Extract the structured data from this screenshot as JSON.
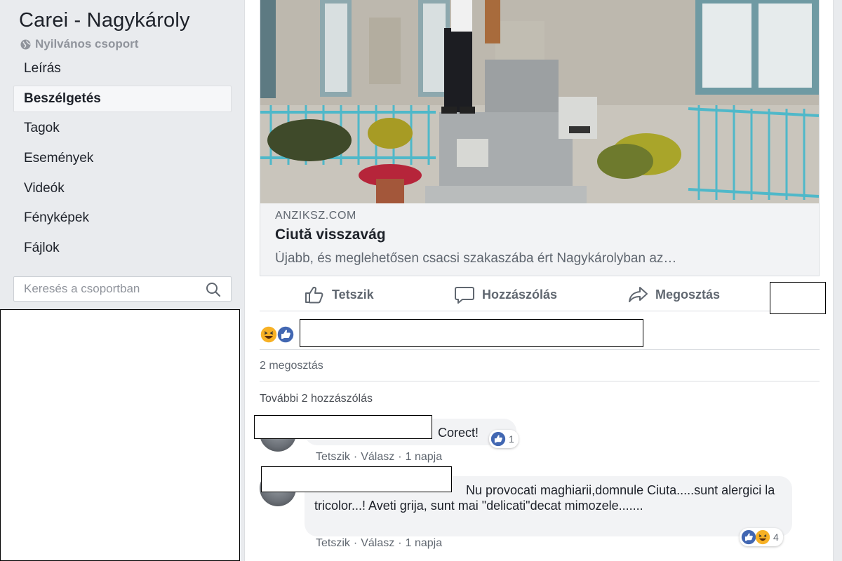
{
  "sidebar": {
    "group_title": "Carei - Nagykároly",
    "privacy": "Nyilvános csoport",
    "nav": [
      {
        "label": "Leírás"
      },
      {
        "label": "Beszélgetés"
      },
      {
        "label": "Tagok"
      },
      {
        "label": "Események"
      },
      {
        "label": "Videók"
      },
      {
        "label": "Fényképek"
      },
      {
        "label": "Fájlok"
      }
    ],
    "active_nav": "Beszélgetés",
    "search": {
      "placeholder": "Keresés a csoportban",
      "value": ""
    }
  },
  "post": {
    "link_preview": {
      "domain": "ANZIKSZ.COM",
      "title": "Ciută visszavág",
      "description": "Újabb, és meglehetősen csacsi szakaszába ért Nagykárolyban az…"
    },
    "actions": {
      "like": "Tetszik",
      "comment": "Hozzászólás",
      "share": "Megosztás"
    },
    "reactions": [
      "haha",
      "like"
    ],
    "shares": "2 megosztás",
    "more_comments": "További 2 hozzászólás"
  },
  "comments": [
    {
      "text": "Corect!",
      "meta": {
        "like": "Tetszik",
        "reply": "Válasz",
        "time": "1 napja"
      },
      "reaction_count": "1",
      "reactions": [
        "like"
      ]
    },
    {
      "text": "Nu provocati maghiarii,domnule Ciuta.....sunt alergici la tricolor...! Aveti grija, sunt mai \"delicati\"decat mimozele.......",
      "meta": {
        "like": "Tetszik",
        "reply": "Válasz",
        "time": "1 napja"
      },
      "reaction_count": "4",
      "reactions": [
        "like",
        "haha"
      ]
    }
  ],
  "colors": {
    "page_bg": "#e9ebee",
    "like_blue": "#4267b2",
    "haha_yellow": "#f7b125",
    "text_secondary": "#606770"
  }
}
